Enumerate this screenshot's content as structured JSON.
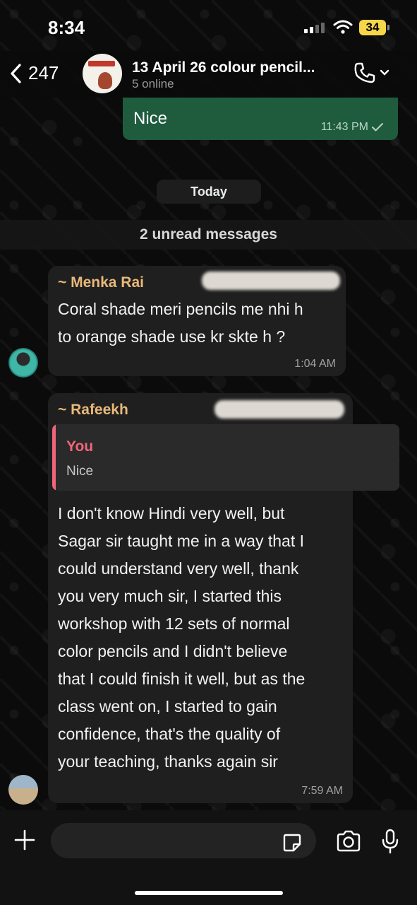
{
  "status": {
    "time": "8:34",
    "battery": "34"
  },
  "header": {
    "back_count": "247",
    "title": "13 April 26 colour pencil...",
    "subtitle": "5 online"
  },
  "messages": {
    "outgoing": {
      "text": "Nice",
      "time": "11:43 PM"
    },
    "date_separator": "Today",
    "unread_banner": "2 unread messages",
    "menka": {
      "sender": "~ Menka Rai",
      "lines": [
        "Coral shade meri pencils me nhi h",
        "to orange shade  use kr skte h ?"
      ],
      "time": "1:04 AM"
    },
    "rafeekh": {
      "sender": "~ Rafeekh",
      "quote_name": "You",
      "quote_text": "Nice",
      "lines": [
        "I don't know Hindi very well, but",
        "Sagar sir taught me in a way that I",
        "could understand very well, thank",
        "you very much sir, I started this",
        "workshop with 12 sets of normal",
        "color pencils and I didn't believe",
        "that I could finish it well, but as the",
        "class went on, I started to gain",
        "confidence, that's the quality of",
        "your teaching, thanks again sir"
      ],
      "time": "7:59 AM"
    }
  },
  "colors": {
    "outgoing_bubble": "#1e5c3d",
    "incoming_bubble": "#1f1f1f",
    "menka_name": "#e9b879",
    "rafeekh_name": "#e9b879",
    "quote_accent": "#f0657b",
    "battery": "#f7d64a"
  },
  "icons": [
    "back-chevron-icon",
    "phone-icon",
    "chevron-down-icon",
    "plus-icon",
    "sticker-icon",
    "camera-icon",
    "mic-icon",
    "double-check-icon"
  ]
}
